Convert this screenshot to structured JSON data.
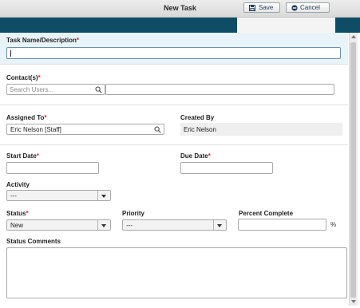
{
  "window": {
    "title": "New Task"
  },
  "toolbar": {
    "save_label": "Save",
    "cancel_label": "Cancel"
  },
  "form": {
    "task_name": {
      "label": "Task Name/Description",
      "value": ""
    },
    "contacts": {
      "label": "Contact(s)",
      "placeholder": "Search Users..."
    },
    "assigned_to": {
      "label": "Assigned To",
      "value": "Eric Nelson [Staff]"
    },
    "created_by": {
      "label": "Created By",
      "value": "Eric Nelson"
    },
    "start_date": {
      "label": "Start Date",
      "value": ""
    },
    "due_date": {
      "label": "Due Date",
      "value": ""
    },
    "activity": {
      "label": "Activity",
      "selected": "---"
    },
    "status": {
      "label": "Status",
      "selected": "New"
    },
    "priority": {
      "label": "Priority",
      "selected": "---"
    },
    "percent_complete": {
      "label": "Percent Complete",
      "value": "",
      "unit": "%"
    },
    "status_comments": {
      "label": "Status Comments",
      "value": ""
    },
    "required_marker": "*"
  },
  "colors": {
    "nav_band": "#0f4d67",
    "required": "#e02020",
    "highlight": "#e8f4fa"
  }
}
